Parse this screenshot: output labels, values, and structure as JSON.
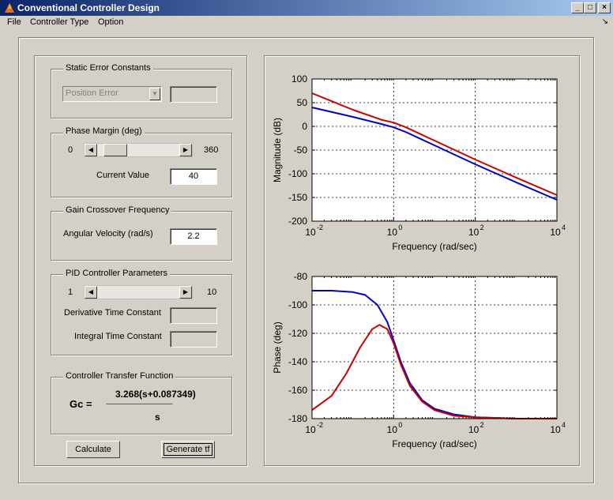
{
  "window": {
    "title": "Conventional Controller Design",
    "min": "_",
    "max": "□",
    "close": "×"
  },
  "menu": [
    "File",
    "Controller Type",
    "Option"
  ],
  "static_error": {
    "title": "Static Error Constants",
    "combo_value": "Position Error",
    "value": ""
  },
  "phase_margin": {
    "title": "Phase Margin (deg)",
    "min": "0",
    "max": "360",
    "current_label": "Current Value",
    "current_value": "40",
    "slider_fraction": 0.11
  },
  "gain_crossover": {
    "title": "Gain Crossover Frequency",
    "label": "Angular Velocity (rad/s)",
    "value": "2.2"
  },
  "pid": {
    "title": "PID Controller Parameters",
    "min": "1",
    "max": "10",
    "derivative_label": "Derivative Time Constant",
    "integral_label": "Integral Time Constant",
    "derivative_value": "",
    "integral_value": ""
  },
  "tf": {
    "title": "Controller Transfer Function",
    "lhs": "Gc  =",
    "numerator": "3.268(s+0.087349)",
    "denominator": "s",
    "divider": "------------------------------------------"
  },
  "buttons": {
    "calculate": "Calculate",
    "generate": "Generate tf"
  },
  "colors": {
    "blue": "#0000c8",
    "red": "#cc0000",
    "titlebar": "#0a246a"
  },
  "chart_data": [
    {
      "type": "line",
      "ylabel": "Magnitude (dB)",
      "xlabel": "Frequency (rad/sec)",
      "xscale": "log",
      "xlim": [
        0.01,
        10000
      ],
      "ylim": [
        -200,
        100
      ],
      "xticks": [
        0.01,
        1,
        100,
        10000
      ],
      "xtick_labels": [
        [
          "10",
          "-2"
        ],
        [
          "10",
          "0"
        ],
        [
          "10",
          "2"
        ],
        [
          "10",
          "4"
        ]
      ],
      "yticks": [
        100,
        50,
        0,
        -50,
        -100,
        -150,
        -200
      ],
      "grid": "dotted",
      "series": [
        {
          "color": "#0000c8",
          "x": [
            0.01,
            0.1,
            0.5,
            1,
            2,
            10,
            100,
            1000,
            10000
          ],
          "y": [
            40,
            20,
            5,
            -2,
            -12,
            -40,
            -80,
            -118,
            -155
          ]
        },
        {
          "color": "#cc0000",
          "x": [
            0.01,
            0.1,
            0.5,
            1,
            2,
            10,
            100,
            1000,
            10000
          ],
          "y": [
            70,
            35,
            14,
            8,
            -2,
            -30,
            -70,
            -108,
            -145
          ]
        }
      ]
    },
    {
      "type": "line",
      "ylabel": "Phase (deg)",
      "xlabel": "Frequency (rad/sec)",
      "xscale": "log",
      "xlim": [
        0.01,
        10000
      ],
      "ylim": [
        -180,
        -80
      ],
      "xticks": [
        0.01,
        1,
        100,
        10000
      ],
      "xtick_labels": [
        [
          "10",
          "-2"
        ],
        [
          "10",
          "0"
        ],
        [
          "10",
          "2"
        ],
        [
          "10",
          "4"
        ]
      ],
      "yticks": [
        -80,
        -100,
        -120,
        -140,
        -160,
        -180
      ],
      "grid": "dotted",
      "series": [
        {
          "color": "#0000c8",
          "x": [
            0.01,
            0.03,
            0.1,
            0.2,
            0.4,
            0.7,
            1,
            1.5,
            2.5,
            5,
            10,
            30,
            100,
            1000,
            10000
          ],
          "y": [
            -90,
            -90,
            -91,
            -93,
            -100,
            -112,
            -125,
            -140,
            -155,
            -167,
            -173,
            -177,
            -179,
            -180,
            -180
          ]
        },
        {
          "color": "#cc0000",
          "x": [
            0.01,
            0.03,
            0.07,
            0.15,
            0.3,
            0.45,
            0.7,
            1,
            1.5,
            2.5,
            5,
            10,
            30,
            100,
            1000,
            10000
          ],
          "y": [
            -174,
            -164,
            -148,
            -130,
            -117,
            -114,
            -117,
            -127,
            -142,
            -157,
            -168,
            -174,
            -178,
            -179,
            -180,
            -180
          ]
        }
      ]
    }
  ]
}
